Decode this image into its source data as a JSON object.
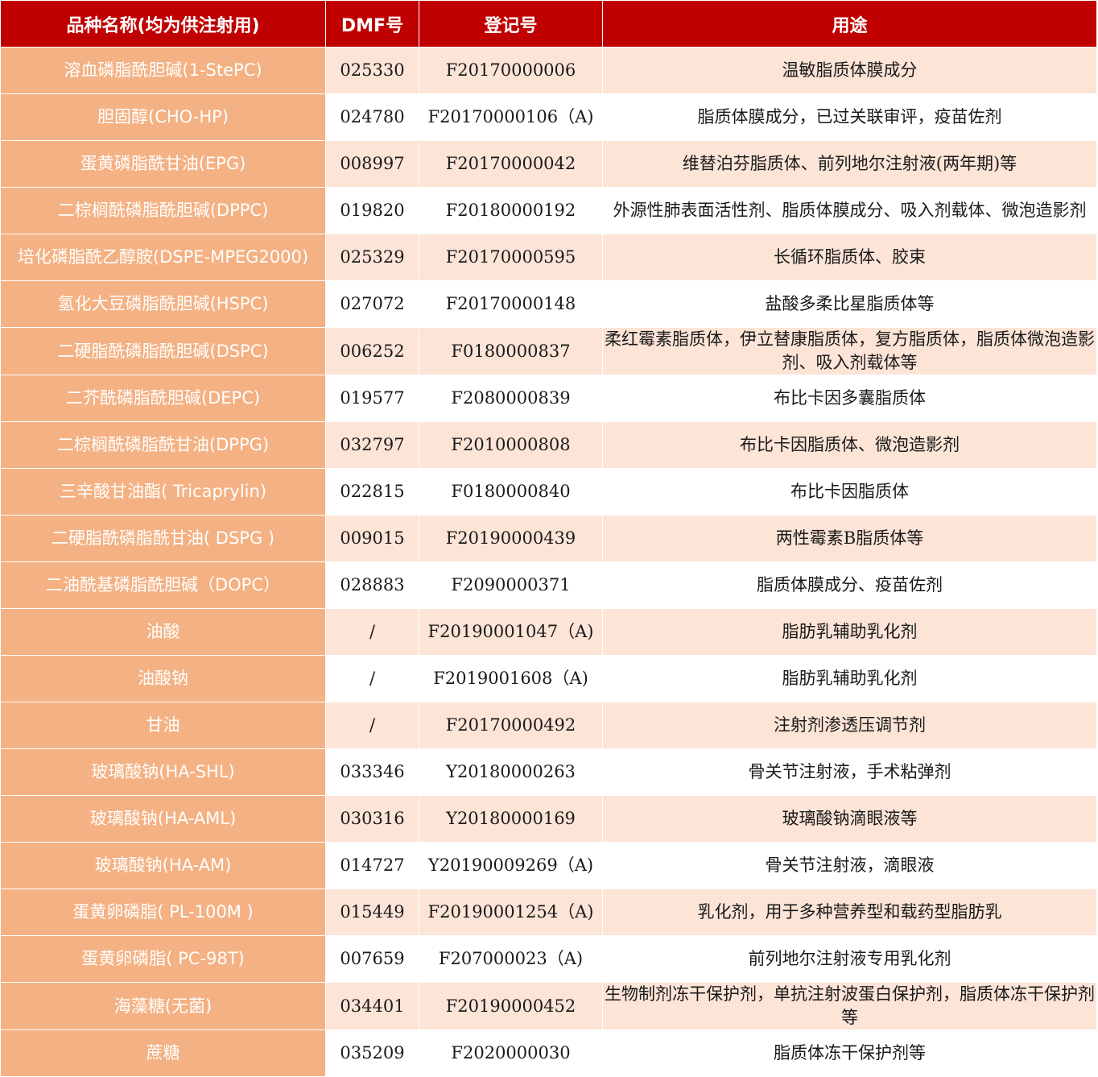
{
  "headers": [
    "品种名称(均为供注射用)",
    "DMF号",
    "登记号",
    "用途"
  ],
  "rows": [
    {
      "name": "溶血磷脂酰胆碱(1-StePC)",
      "dmf": "025330",
      "reg": "F20170000006",
      "use": "温敏脂质体膜成分"
    },
    {
      "name": "胆固醇(CHO-HP)",
      "dmf": "024780",
      "reg": "F20170000106（A)",
      "use": "脂质体膜成分，已过关联审评，疫苗佐剂"
    },
    {
      "name": "蛋黄磷脂酰甘油(EPG)",
      "dmf": "008997",
      "reg": "F20170000042",
      "use": "维替泊芬脂质体、前列地尔注射液(两年期)等"
    },
    {
      "name": "二棕榈酰磷脂酰胆碱(DPPC)",
      "dmf": "019820",
      "reg": "F20180000192",
      "use": "外源性肺表面活性剂、脂质体膜成分、吸入剂载体、微泡造影剂"
    },
    {
      "name": "培化磷脂酰乙醇胺(DSPE-MPEG2000)",
      "dmf": "025329",
      "reg": "F20170000595",
      "use": "长循环脂质体、胶束"
    },
    {
      "name": "氢化大豆磷脂酰胆碱(HSPC)",
      "dmf": "027072",
      "reg": "F20170000148",
      "use": "盐酸多柔比星脂质体等"
    },
    {
      "name": "二硬脂酰磷脂酰胆碱(DSPC)",
      "dmf": "006252",
      "reg": "F0180000837",
      "use": "柔红霉素脂质体，伊立替康脂质体，复方脂质体，脂质体微泡造影剂、吸入剂载体等"
    },
    {
      "name": "二芥酰磷脂酰胆碱(DEPC)",
      "dmf": "019577",
      "reg": "F2080000839",
      "use": "布比卡因多囊脂质体"
    },
    {
      "name": "二棕榈酰磷脂酰甘油(DPPG)",
      "dmf": "032797",
      "reg": "F2010000808",
      "use": "布比卡因脂质体、微泡造影剂"
    },
    {
      "name": "三辛酸甘油酯( Tricaprylin)",
      "dmf": "022815",
      "reg": "F0180000840",
      "use": "布比卡因脂质体"
    },
    {
      "name": "二硬脂酰磷脂酰甘油( DSPG )",
      "dmf": "009015",
      "reg": "F20190000439",
      "use": "两性霉素B脂质体等"
    },
    {
      "name": "二油酰基磷脂酰胆碱（DOPC）",
      "dmf": "028883",
      "reg": "F2090000371",
      "use": "脂质体膜成分、疫苗佐剂"
    },
    {
      "name": "油酸",
      "dmf": "/",
      "reg": "F20190001047（A)",
      "use": "脂肪乳辅助乳化剂"
    },
    {
      "name": "油酸钠",
      "dmf": "/",
      "reg": "F2019001608（A)",
      "use": "脂肪乳辅助乳化剂"
    },
    {
      "name": "甘油",
      "dmf": "/",
      "reg": "F20170000492",
      "use": "注射剂渗透压调节剂"
    },
    {
      "name": "玻璃酸钠(HA-SHL)",
      "dmf": "033346",
      "reg": "Y20180000263",
      "use": "骨关节注射液，手术粘弹剂"
    },
    {
      "name": "玻璃酸钠(HA-AML)",
      "dmf": "030316",
      "reg": "Y20180000169",
      "use": "玻璃酸钠滴眼液等"
    },
    {
      "name": "玻璃酸钠(HA-AM)",
      "dmf": "014727",
      "reg": "Y20190009269（A)",
      "use": "骨关节注射液，滴眼液"
    },
    {
      "name": "蛋黄卵磷脂( PL-100M )",
      "dmf": "015449",
      "reg": "F20190001254（A)",
      "use": "乳化剂，用于多种营养型和载药型脂肪乳"
    },
    {
      "name": "蛋黄卵磷脂( PC-98T)",
      "dmf": "007659",
      "reg": "F207000023（A)",
      "use": "前列地尔注射液专用乳化剂"
    },
    {
      "name": "海藻糖(无菌)",
      "dmf": "034401",
      "reg": "F20190000452",
      "use": "生物制剂冻干保护剂，单抗注射波蛋白保护剂，脂质体冻干保护剂等"
    },
    {
      "name": "蔗糖",
      "dmf": "035209",
      "reg": "F2020000030",
      "use": "脂质体冻干保护剂等"
    }
  ]
}
